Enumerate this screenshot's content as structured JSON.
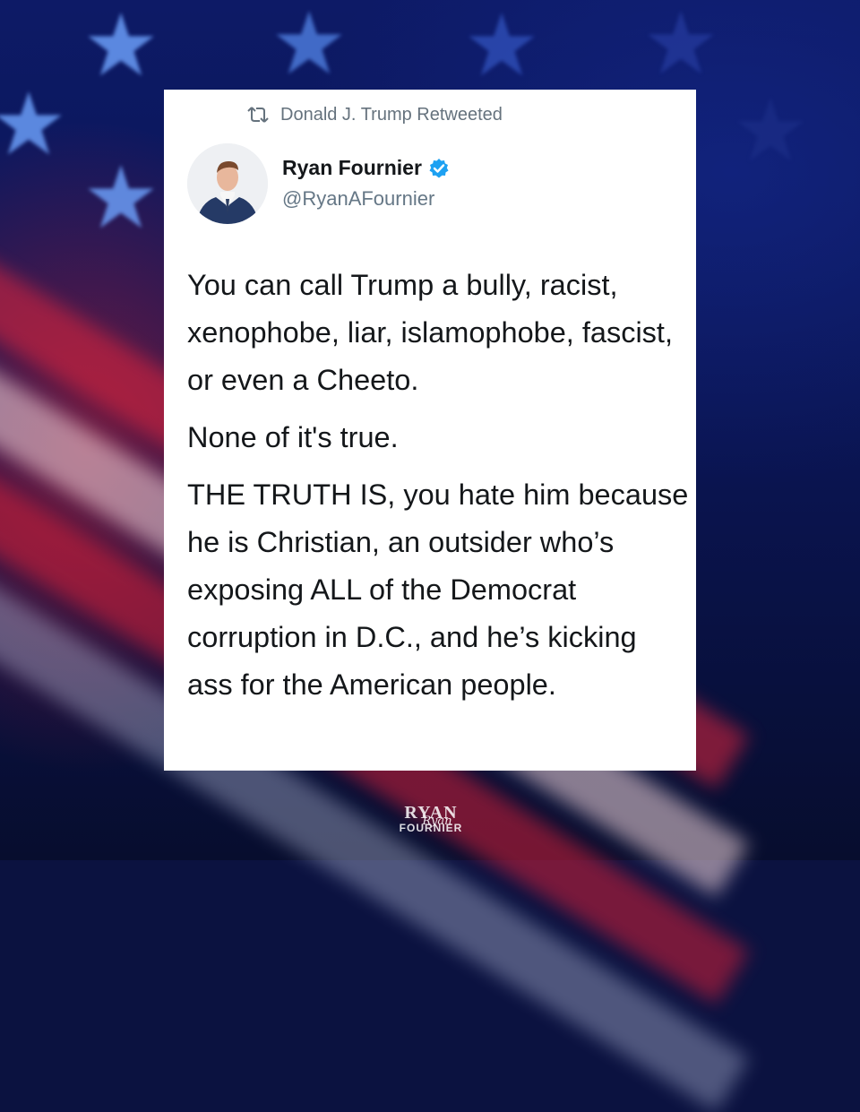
{
  "retweet": {
    "icon": "retweet-icon",
    "text": "Donald J. Trump Retweeted"
  },
  "author": {
    "display_name": "Ryan Fournier",
    "handle": "@RyanAFournier",
    "verified_icon": "verified-badge-icon",
    "verified_color": "#1da1f2"
  },
  "tweet": {
    "paragraphs": [
      "You can call Trump a bully, racist, xenophobe, liar, islamophobe, fascist, or even a Cheeto.",
      "None of it's true.",
      "THE TRUTH IS, you hate him because he is Christian, an outsider who’s exposing ALL of the Democrat corruption in D.C., and he’s kicking ass for the American people."
    ]
  },
  "watermark": {
    "line1": "RYAN",
    "line2": "FOURNIER",
    "script": "Ryan"
  },
  "colors": {
    "card": "#ffffff",
    "text": "#14171a",
    "secondary_text": "#657786",
    "background_blue": "#0d1a66",
    "background_red": "#c81e32"
  }
}
